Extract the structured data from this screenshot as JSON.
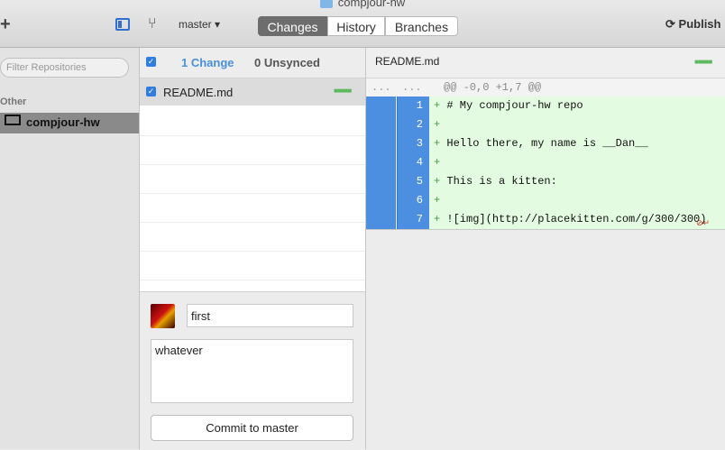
{
  "window": {
    "title": "compjour-hw"
  },
  "toolbar": {
    "add_label": "+",
    "branch_label": "master ▾",
    "tabs": [
      "Changes",
      "History",
      "Branches"
    ],
    "active_tab": "Changes",
    "publish_label": "Publish"
  },
  "sidebar": {
    "filter_placeholder": "Filter Repositories",
    "section": "Other",
    "repos": [
      {
        "name": "compjour-hw",
        "selected": true
      }
    ]
  },
  "changes": {
    "count_label": "1 Change",
    "unsynced_label": "0 Unsynced",
    "files": [
      {
        "name": "README.md",
        "checked": true
      }
    ]
  },
  "commit": {
    "summary": "first",
    "description": "whatever",
    "button_label": "Commit to master"
  },
  "diff": {
    "filename": "README.md",
    "hunk_left": "...",
    "hunk_right": "...",
    "hunk_header": "@@ -0,0 +1,7 @@",
    "lines": [
      {
        "num": "1",
        "text": "# My compjour-hw repo"
      },
      {
        "num": "2",
        "text": ""
      },
      {
        "num": "3",
        "text": "Hello there, my name is __Dan__"
      },
      {
        "num": "4",
        "text": ""
      },
      {
        "num": "5",
        "text": "This is a kitten:"
      },
      {
        "num": "6",
        "text": ""
      },
      {
        "num": "7",
        "text": "![img](http://placekitten.com/g/300/300)"
      }
    ]
  },
  "colors": {
    "accent": "#2f7de1",
    "added_bg": "#e3fbe0",
    "gutter": "#4c8ee0"
  },
  "icons": [
    "folder-icon",
    "sidebar-toggle-icon",
    "branch-icon",
    "sync-icon",
    "monitor-icon",
    "checkbox-icon"
  ]
}
